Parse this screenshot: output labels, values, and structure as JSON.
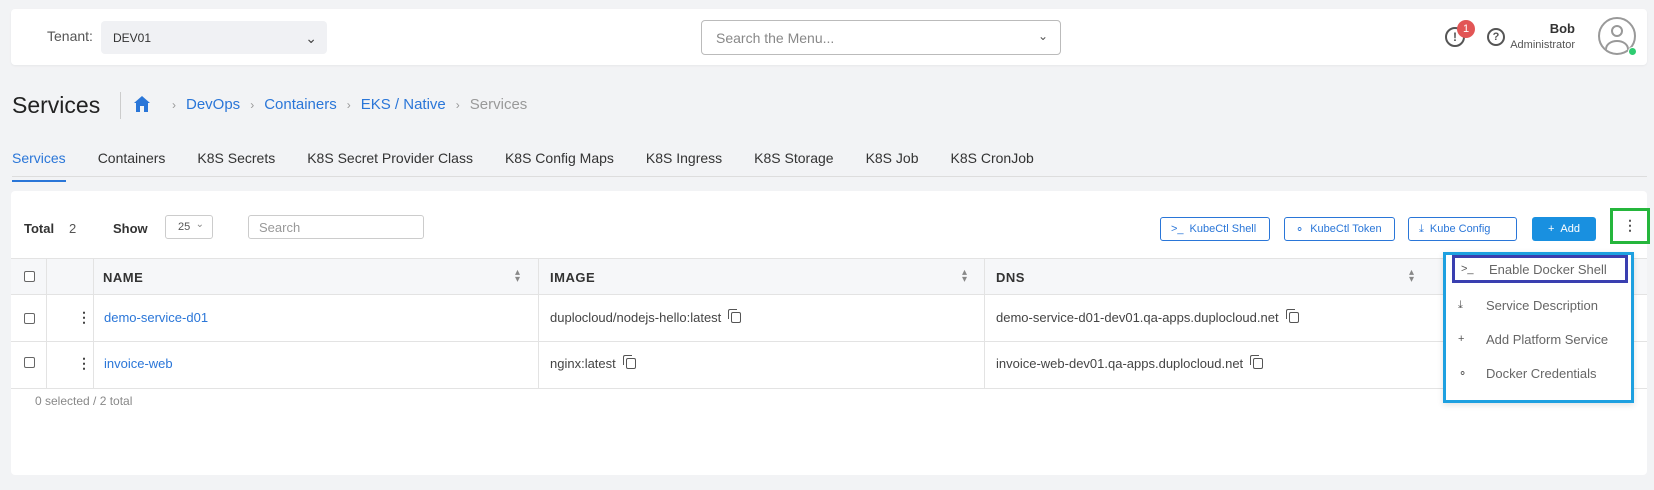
{
  "header": {
    "tenant_label": "Tenant:",
    "tenant_value": "DEV01",
    "menu_search_placeholder": "Search the Menu...",
    "alert_count": "1",
    "user_name": "Bob",
    "user_role": "Administrator"
  },
  "page": {
    "title": "Services",
    "breadcrumb": [
      "DevOps",
      "Containers",
      "EKS / Native",
      "Services"
    ]
  },
  "tabs": [
    "Services",
    "Containers",
    "K8S Secrets",
    "K8S Secret Provider Class",
    "K8S Config Maps",
    "K8S Ingress",
    "K8S Storage",
    "K8S Job",
    "K8S CronJob"
  ],
  "toolbar": {
    "total_label": "Total",
    "total_value": "2",
    "show_label": "Show",
    "show_value": "25",
    "search_placeholder": "Search",
    "kubectl_shell": "KubeCtl Shell",
    "kubectl_token": "KubeCtl Token",
    "kube_config": "Kube Config",
    "add": "Add"
  },
  "table": {
    "columns": [
      "NAME",
      "IMAGE",
      "DNS"
    ],
    "rows": [
      {
        "name": "demo-service-d01",
        "image": "duplocloud/nodejs-hello:latest",
        "dns": "demo-service-d01-dev01.qa-apps.duplocloud.net"
      },
      {
        "name": "invoice-web",
        "image": "nginx:latest",
        "dns": "invoice-web-dev01.qa-apps.duplocloud.net"
      }
    ],
    "footer": "0 selected / 2 total"
  },
  "dropdown": {
    "items": [
      {
        "icon": "terminal-icon",
        "label": "Enable Docker Shell"
      },
      {
        "icon": "download-icon",
        "label": "Service Description"
      },
      {
        "icon": "plus-icon",
        "label": "Add Platform Service"
      },
      {
        "icon": "key-icon",
        "label": "Docker Credentials"
      }
    ]
  },
  "colors": {
    "primary": "#2a76d8",
    "add_button": "#1990e0",
    "alert_badge": "#e25555",
    "kebab_highlight": "#25b63c",
    "dropdown_border": "#1ea0e0",
    "dropdown_item_highlight": "#3a3fb0"
  }
}
